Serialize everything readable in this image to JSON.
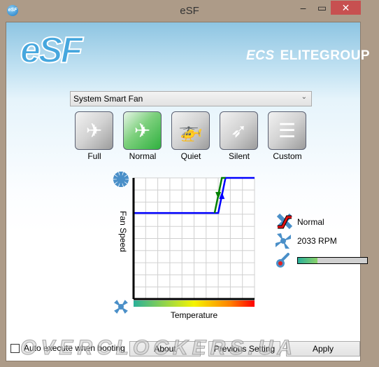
{
  "window": {
    "title": "eSF",
    "app_icon_text": "eSF",
    "minimize": "‒",
    "maximize": "▭",
    "close": "✕"
  },
  "header": {
    "logo": "eSF",
    "brand_mark": "ECS",
    "brand_name": "ELITEGROUP"
  },
  "mode_select": {
    "value": "System Smart Fan"
  },
  "modes": [
    {
      "label": "Full",
      "icon": "fighter-jet-icon",
      "glyph": "✈",
      "active": false
    },
    {
      "label": "Normal",
      "icon": "airliner-icon",
      "glyph": "✈",
      "active": true
    },
    {
      "label": "Quiet",
      "icon": "helicopter-icon",
      "glyph": "🚁",
      "active": false
    },
    {
      "label": "Silent",
      "icon": "paper-plane-icon",
      "glyph": "➶",
      "active": false
    },
    {
      "label": "Custom",
      "icon": "sliders-icon",
      "glyph": "☰",
      "active": false
    }
  ],
  "chart_data": {
    "type": "line",
    "xlabel": "Temperature",
    "ylabel": "Fan Speed",
    "xlim": [
      0,
      100
    ],
    "ylim": [
      0,
      100
    ],
    "grid": true,
    "series": [
      {
        "color": "#0000ff",
        "direction": "rising",
        "points": [
          [
            0,
            71
          ],
          [
            70,
            71
          ],
          [
            76,
            100
          ],
          [
            100,
            100
          ]
        ]
      },
      {
        "color": "#008000",
        "direction": "falling",
        "points": [
          [
            67,
            71
          ],
          [
            73,
            100
          ],
          [
            76,
            100
          ]
        ]
      }
    ]
  },
  "status": {
    "mode": "Normal",
    "fan_rpm": "2033 RPM",
    "temperature_level": 0.28
  },
  "footer": {
    "auto_execute_label": "Auto execute when booting",
    "auto_execute_checked": false,
    "about": "About",
    "previous": "Previous Setting",
    "apply": "Apply"
  },
  "watermark": "OVERCLOCKERS.UA",
  "colors": {
    "active_mode": "#2fb03f",
    "close": "#c75050",
    "frame": "#ad9b88"
  }
}
